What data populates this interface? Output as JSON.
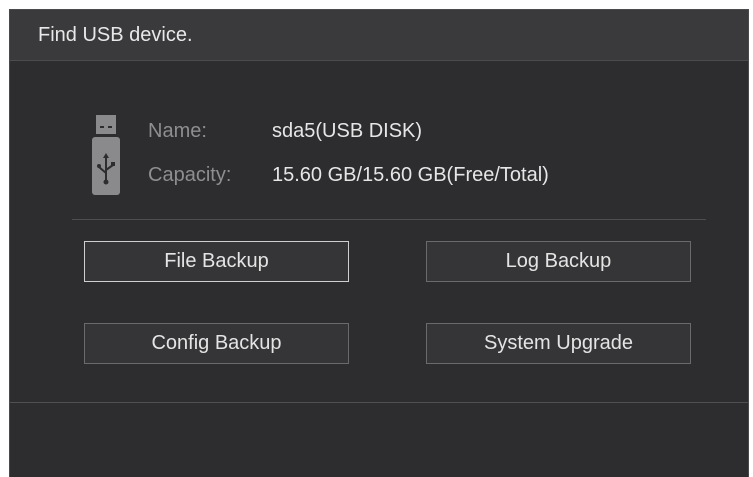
{
  "dialog": {
    "title": "Find USB device."
  },
  "device": {
    "icon": "usb-drive-icon",
    "name_label": "Name:",
    "name_value": "sda5(USB DISK)",
    "capacity_label": "Capacity:",
    "capacity_value": "15.60 GB/15.60 GB(Free/Total)"
  },
  "buttons": {
    "file_backup": "File Backup",
    "log_backup": "Log Backup",
    "config_backup": "Config Backup",
    "system_upgrade": "System Upgrade"
  },
  "colors": {
    "background": "#2d2d2f",
    "titlebar": "#3a3a3c",
    "text": "#e6e6e6",
    "label": "#8e8e90",
    "selected_border": "#cfcfd1"
  }
}
